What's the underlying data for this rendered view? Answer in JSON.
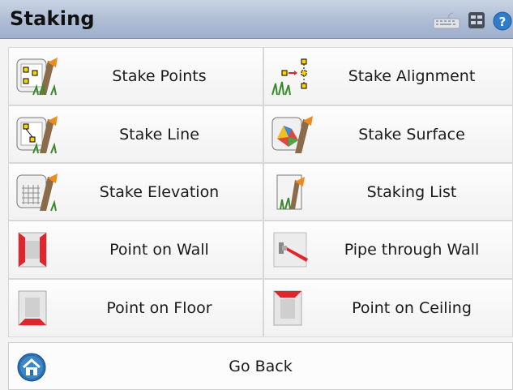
{
  "window": {
    "title": "Staking"
  },
  "toolbar_icons": [
    "keyboard-icon",
    "layout-icon",
    "help-icon"
  ],
  "menu": [
    {
      "label": "Stake Points",
      "icon": "stake-points-icon"
    },
    {
      "label": "Stake Alignment",
      "icon": "stake-alignment-icon"
    },
    {
      "label": "Stake Line",
      "icon": "stake-line-icon"
    },
    {
      "label": "Stake Surface",
      "icon": "stake-surface-icon"
    },
    {
      "label": "Stake Elevation",
      "icon": "stake-elevation-icon"
    },
    {
      "label": "Staking List",
      "icon": "staking-list-icon"
    },
    {
      "label": "Point on Wall",
      "icon": "point-on-wall-icon"
    },
    {
      "label": "Pipe through Wall",
      "icon": "pipe-through-wall-icon"
    },
    {
      "label": "Point on Floor",
      "icon": "point-on-floor-icon"
    },
    {
      "label": "Point on Ceiling",
      "icon": "point-on-ceiling-icon"
    }
  ],
  "footer": {
    "go_back_label": "Go Back",
    "icon": "home-icon"
  },
  "colors": {
    "accent_red": "#e0262d",
    "header": "#aebcd4",
    "home_blue": "#2a6fb0"
  }
}
